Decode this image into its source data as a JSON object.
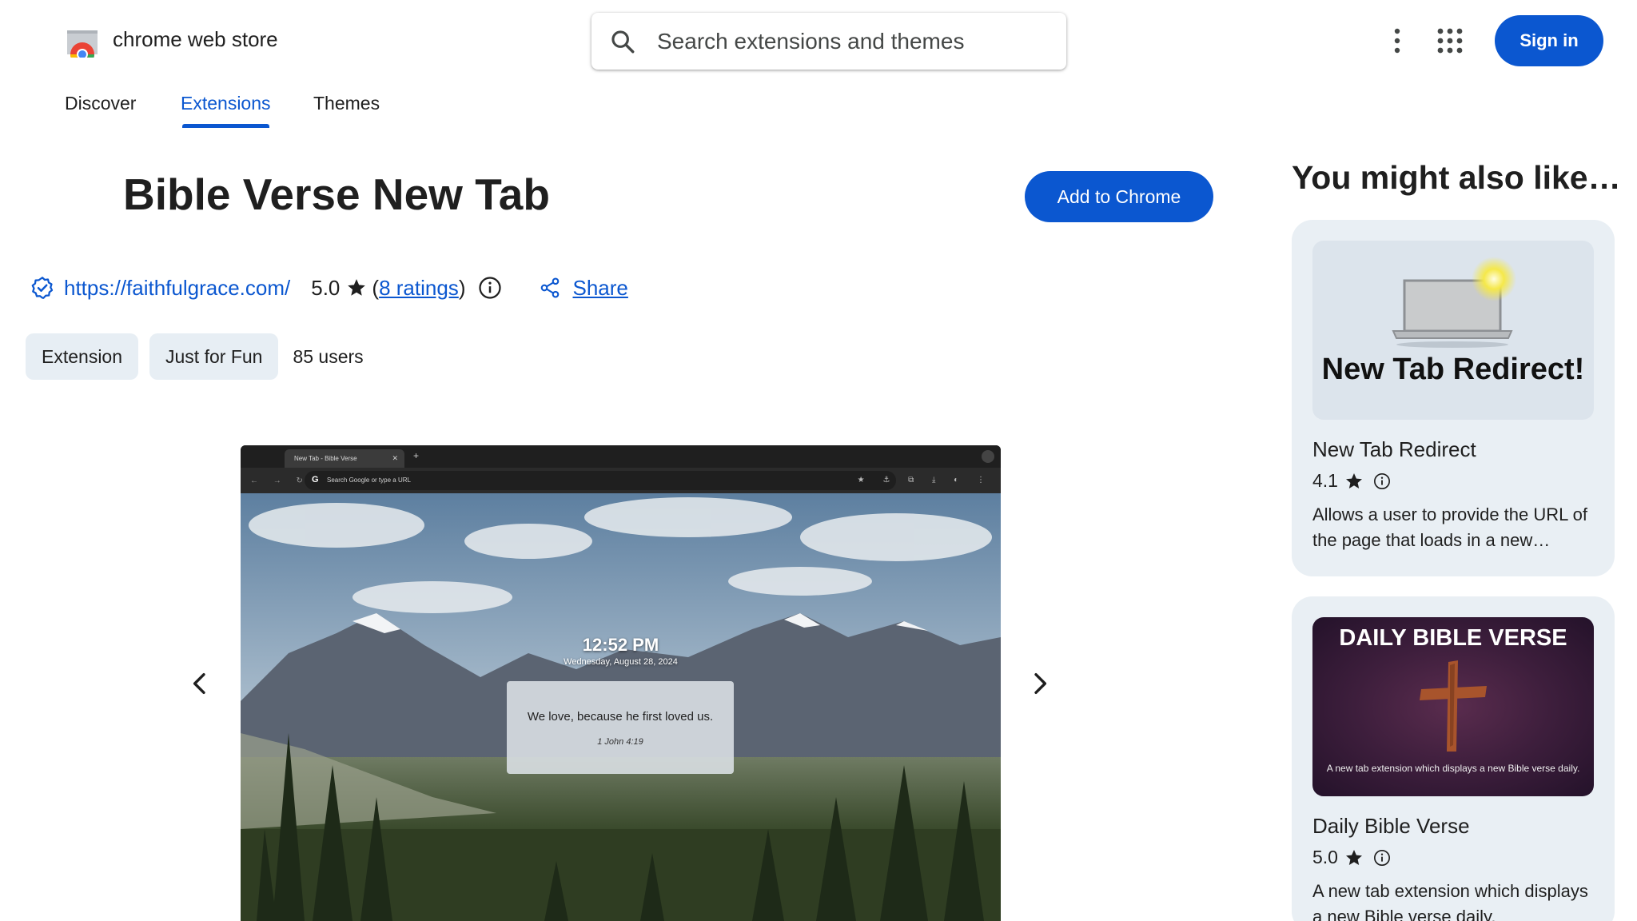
{
  "header": {
    "brand": "chrome web store",
    "search_placeholder": "Search extensions and themes",
    "sign_in_label": "Sign in"
  },
  "nav": {
    "tabs": [
      {
        "label": "Discover",
        "active": false
      },
      {
        "label": "Extensions",
        "active": true
      },
      {
        "label": "Themes",
        "active": false
      }
    ]
  },
  "extension": {
    "title": "Bible Verse New Tab",
    "add_button_label": "Add to Chrome",
    "website": "https://faithfulgrace.com/",
    "rating": "5.0",
    "paren_open": "(",
    "ratings_link": "8 ratings",
    "paren_close": ")",
    "share_label": "Share",
    "chips": [
      "Extension",
      "Just for Fun"
    ],
    "users": "85 users"
  },
  "screenshot": {
    "browser_tab_title": "New Tab - Bible Verse",
    "close_glyph": "✕",
    "new_tab_glyph": "+",
    "omnibox_text": "Search Google or type a URL",
    "google_glyph": "G",
    "nav_glyphs": "← → ↻",
    "toolbar_glyphs": "★ ⚓ ⧉ ⤓ ◐ ⋮",
    "clock": "12:52 PM",
    "date": "Wednesday, August 28, 2024",
    "verse": "We love, because he first loved us.",
    "verse_ref": "1 John 4:19"
  },
  "sidebar": {
    "title": "You might also like…",
    "recommendations": [
      {
        "thumb_text": "New Tab Redirect!",
        "name": "New Tab Redirect",
        "rating": "4.1",
        "description": "Allows a user to provide the URL of the page that loads in a new…"
      },
      {
        "thumb_title": "DAILY BIBLE VERSE",
        "thumb_sub": "A new tab extension which displays a new Bible verse daily.",
        "name": "Daily Bible Verse",
        "rating": "5.0",
        "description": "A new tab extension which displays a new Bible verse daily."
      }
    ]
  },
  "colors": {
    "accent": "#0b57d0",
    "chip_bg": "#e7eef4",
    "card_bg": "#e9eff4"
  },
  "icons": [
    "chrome-logo-icon",
    "search-icon",
    "more-vert-icon",
    "apps-grid-icon",
    "verified-icon",
    "star-icon",
    "info-icon",
    "share-icon",
    "chevron-left-icon",
    "chevron-right-icon"
  ]
}
